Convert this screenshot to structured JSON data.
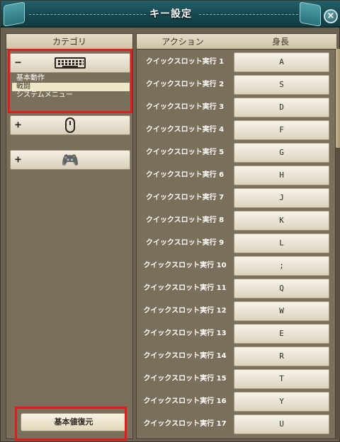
{
  "window": {
    "title": "キー設定",
    "close_label": "×"
  },
  "categories": {
    "header": "カテゴリ",
    "groups": [
      {
        "sign": "−",
        "icon": "keyboard-icon",
        "expanded": true
      },
      {
        "sign": "+",
        "icon": "mouse-icon",
        "expanded": false
      },
      {
        "sign": "+",
        "icon": "gamepad-icon",
        "expanded": false,
        "glyph": "🎮"
      }
    ],
    "subitems": [
      "基本動作",
      "戦闘",
      "システムメニュー"
    ],
    "selected_subitem": "戦闘",
    "reset_label": "基本値復元"
  },
  "bindings": {
    "header_action": "アクション",
    "header_key": "身長",
    "rows": [
      {
        "action": "クイックスロット実行 1",
        "key": "A"
      },
      {
        "action": "クイックスロット実行 2",
        "key": "S"
      },
      {
        "action": "クイックスロット実行 3",
        "key": "D"
      },
      {
        "action": "クイックスロット実行 4",
        "key": "F"
      },
      {
        "action": "クイックスロット実行 5",
        "key": "G"
      },
      {
        "action": "クイックスロット実行 6",
        "key": "H"
      },
      {
        "action": "クイックスロット実行 7",
        "key": "J"
      },
      {
        "action": "クイックスロット実行 8",
        "key": "K"
      },
      {
        "action": "クイックスロット実行 9",
        "key": "L"
      },
      {
        "action": "クイックスロット実行 10",
        "key": ";"
      },
      {
        "action": "クイックスロット実行 11",
        "key": "Q"
      },
      {
        "action": "クイックスロット実行 12",
        "key": "W"
      },
      {
        "action": "クイックスロット実行 13",
        "key": "E"
      },
      {
        "action": "クイックスロット実行 14",
        "key": "R"
      },
      {
        "action": "クイックスロット実行 15",
        "key": "T"
      },
      {
        "action": "クイックスロット実行 16",
        "key": "Y"
      },
      {
        "action": "クイックスロット実行 17",
        "key": "U"
      }
    ]
  },
  "colors": {
    "titlebar": "#17484f",
    "highlight": "#e41b1b",
    "panel": "#7a6f5b"
  }
}
